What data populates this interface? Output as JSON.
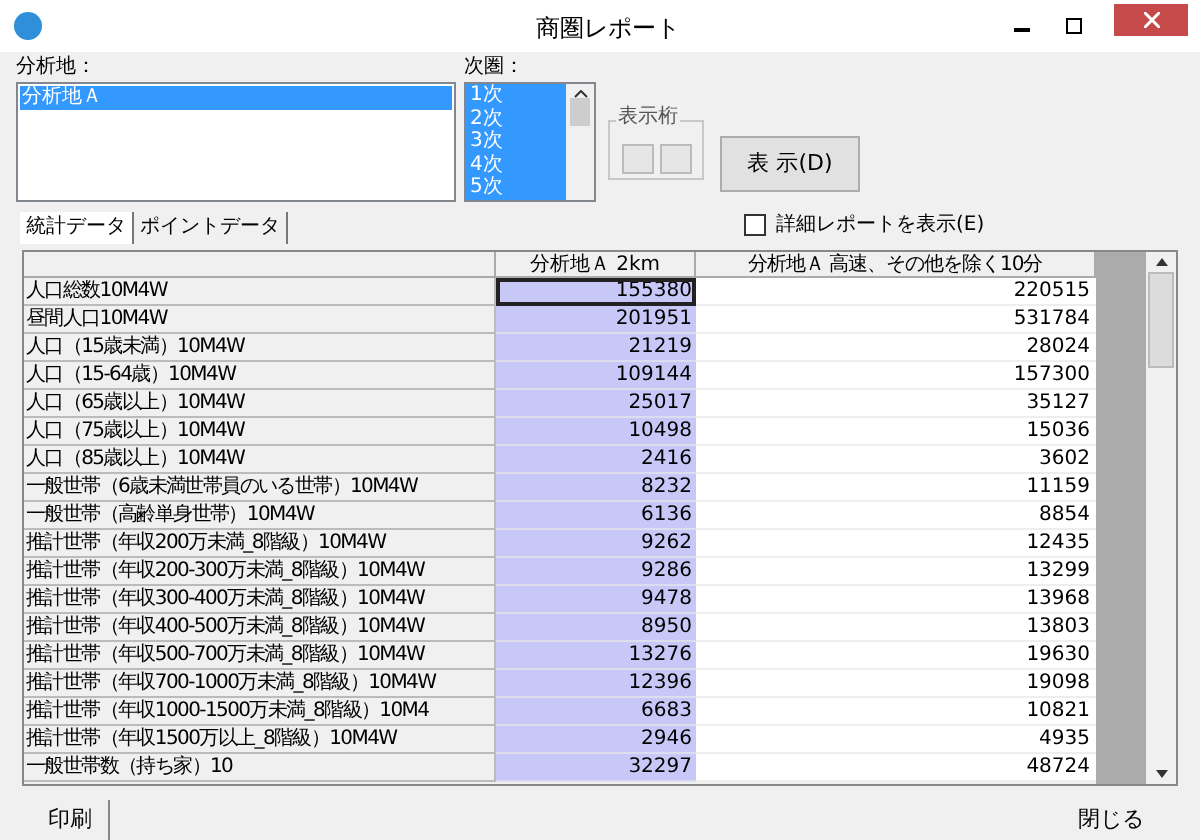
{
  "window": {
    "title": "商圏レポート"
  },
  "sites": {
    "label": "分析地：",
    "items": [
      {
        "label": "分析地Ａ",
        "selected": true
      }
    ]
  },
  "rings": {
    "label": "次圏：",
    "items": [
      {
        "label": "1次",
        "selected": true
      },
      {
        "label": "2次",
        "selected": true
      },
      {
        "label": "3次",
        "selected": true
      },
      {
        "label": "4次",
        "selected": true
      },
      {
        "label": "5次",
        "selected": true
      }
    ]
  },
  "digits": {
    "label": "表示桁"
  },
  "show_button": {
    "label": "表 示(D)"
  },
  "tabs": [
    {
      "label": "統計データ",
      "selected": true
    },
    {
      "label": "ポイントデータ",
      "selected": false
    }
  ],
  "detail_checkbox": {
    "label": "詳細レポートを表示(E)",
    "checked": false
  },
  "table": {
    "columns": [
      "分析地Ａ  2km",
      "分析地Ａ  高速、その他を除く10分"
    ],
    "rows": [
      {
        "label": "人口総数10M4W",
        "values": [
          "155380",
          "220515"
        ],
        "focused": true
      },
      {
        "label": "昼間人口10M4W",
        "values": [
          "201951",
          "531784"
        ],
        "focused": false
      },
      {
        "label": "人口（15歳未満）10M4W",
        "values": [
          "21219",
          "28024"
        ],
        "focused": false
      },
      {
        "label": "人口（15-64歳）10M4W",
        "values": [
          "109144",
          "157300"
        ],
        "focused": false
      },
      {
        "label": "人口（65歳以上）10M4W",
        "values": [
          "25017",
          "35127"
        ],
        "focused": false
      },
      {
        "label": "人口（75歳以上）10M4W",
        "values": [
          "10498",
          "15036"
        ],
        "focused": false
      },
      {
        "label": "人口（85歳以上）10M4W",
        "values": [
          "2416",
          "3602"
        ],
        "focused": false
      },
      {
        "label": "一般世帯（6歳未満世帯員のいる世帯）10M4W",
        "values": [
          "8232",
          "11159"
        ],
        "focused": false
      },
      {
        "label": "一般世帯（高齢単身世帯）10M4W",
        "values": [
          "6136",
          "8854"
        ],
        "focused": false
      },
      {
        "label": "推計世帯（年収200万未満_8階級）10M4W",
        "values": [
          "9262",
          "12435"
        ],
        "focused": false
      },
      {
        "label": "推計世帯（年収200-300万未満_8階級）10M4W",
        "values": [
          "9286",
          "13299"
        ],
        "focused": false
      },
      {
        "label": "推計世帯（年収300-400万未満_8階級）10M4W",
        "values": [
          "9478",
          "13968"
        ],
        "focused": false
      },
      {
        "label": "推計世帯（年収400-500万未満_8階級）10M4W",
        "values": [
          "8950",
          "13803"
        ],
        "focused": false
      },
      {
        "label": "推計世帯（年収500-700万未満_8階級）10M4W",
        "values": [
          "13276",
          "19630"
        ],
        "focused": false
      },
      {
        "label": "推計世帯（年収700-1000万未満_8階級）10M4W",
        "values": [
          "12396",
          "19098"
        ],
        "focused": false
      },
      {
        "label": "推計世帯（年収1000-1500万未満_8階級）10M4",
        "values": [
          "6683",
          "10821"
        ],
        "focused": false
      },
      {
        "label": "推計世帯（年収1500万以上_8階級）10M4W",
        "values": [
          "2946",
          "4935"
        ],
        "focused": false
      },
      {
        "label": "一般世帯数（持ち家）10",
        "values": [
          "32297",
          "48724"
        ],
        "focused": false
      }
    ]
  },
  "footer": {
    "print": "印刷",
    "close": "閉じる"
  }
}
